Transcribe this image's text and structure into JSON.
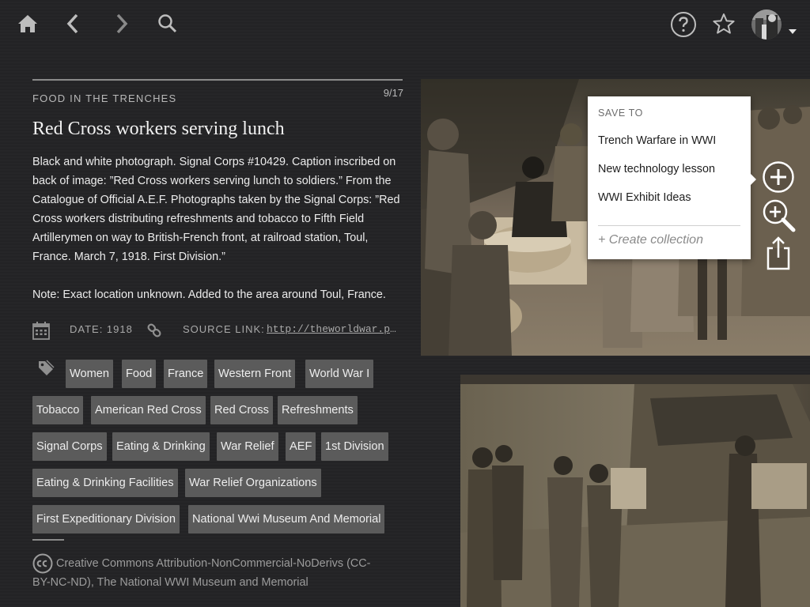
{
  "nav": {
    "icons": [
      "home-icon",
      "back-icon",
      "forward-icon",
      "search-icon",
      "help-icon",
      "star-icon",
      "avatar",
      "caret-down-icon"
    ]
  },
  "item": {
    "kicker": "FOOD IN THE TRENCHES",
    "counter": "9/17",
    "title": "Red Cross workers serving lunch",
    "description": "Black and white photograph. Signal Corps #10429. Caption inscribed on back of image: ”Red Cross workers serving lunch to soldiers.” From the Catalogue of Official A.E.F. Photographs taken by the Signal Corps: ”Red Cross workers distributing refreshments and tobacco to Fifth Field Artillerymen on way to British-French front, at railroad station, Toul, France. March 7, 1918. First Division.”",
    "note": "Note: Exact location unknown. Added to the area around Toul, France.",
    "date_label": "DATE: 1918",
    "source_label": "SOURCE LINK:",
    "source_link": "http://theworldwar.pa…",
    "tags": [
      "Women",
      "Food",
      "France",
      "Western Front",
      "World War I",
      "Tobacco",
      "American Red Cross",
      "Red Cross",
      "Refreshments",
      "Signal Corps",
      "Eating & Drinking",
      "War Relief",
      "AEF",
      "1st Division",
      "Eating & Drinking Facilities",
      "War Relief Organizations",
      "First Expeditionary Division",
      "National Wwi Museum And Memorial"
    ],
    "license": "Creative Commons Attribution-NonCommercial-NoDerivs (CC-BY-NC-ND), The National WWI Museum and Memorial"
  },
  "popup": {
    "heading": "SAVE TO",
    "collections": [
      "Trench Warfare in WWI",
      "New technology lesson",
      "WWI Exhibit Ideas"
    ],
    "create_label": "+ Create collection"
  },
  "tools": [
    "add-circle-icon",
    "zoom-in-icon",
    "share-icon"
  ],
  "colors": {
    "background": "#232325",
    "tag_bg": "#5b5b5b",
    "popup_bg": "#ffffff"
  }
}
